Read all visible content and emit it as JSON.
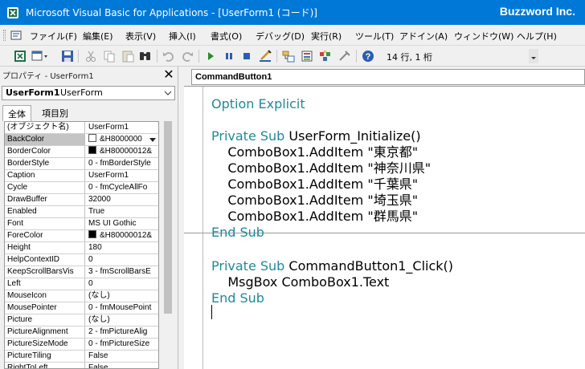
{
  "window": {
    "title": "Microsoft Visual Basic for Applications - [UserForm1 (コード)]",
    "brand": "Buzzword Inc."
  },
  "menu": [
    {
      "id": "file",
      "label": "ファイル(F)"
    },
    {
      "id": "edit",
      "label": "編集(E)"
    },
    {
      "id": "view",
      "label": "表示(V)"
    },
    {
      "id": "insert",
      "label": "挿入(I)"
    },
    {
      "id": "format",
      "label": "書式(O)"
    },
    {
      "id": "debug",
      "label": "デバッグ(D)"
    },
    {
      "id": "run",
      "label": "実行(R)"
    },
    {
      "id": "tools",
      "label": "ツール(T)"
    },
    {
      "id": "addins",
      "label": "アドイン(A)"
    },
    {
      "id": "window",
      "label": "ウィンドウ(W)"
    },
    {
      "id": "help",
      "label": "ヘルプ(H)"
    }
  ],
  "toolbar": {
    "position": "14 行, 1 桁",
    "icons": [
      "excel-icon",
      "insert-dropdown-icon",
      "save-icon",
      "cut-icon",
      "copy-icon",
      "paste-icon",
      "find-icon",
      "undo-icon",
      "redo-icon",
      "run-icon",
      "break-icon",
      "reset-icon",
      "design-mode-icon",
      "project-explorer-icon",
      "properties-icon",
      "object-browser-icon",
      "toolbox-icon",
      "help-icon"
    ]
  },
  "properties": {
    "title": "プロパティ - UserForm1",
    "object_name": "UserForm1",
    "object_type": "UserForm",
    "tabs": [
      "全体",
      "項目別"
    ],
    "rows": [
      {
        "name": "(オブジェクト名)",
        "value": "UserForm1"
      },
      {
        "name": "BackColor",
        "value": "&H8000000",
        "swatch": "#ffffff",
        "selected": true
      },
      {
        "name": "BorderColor",
        "value": "&H80000012&",
        "swatch": "#000000"
      },
      {
        "name": "BorderStyle",
        "value": "0 - fmBorderStyle"
      },
      {
        "name": "Caption",
        "value": "UserForm1"
      },
      {
        "name": "Cycle",
        "value": "0 - fmCycleAllFo"
      },
      {
        "name": "DrawBuffer",
        "value": "32000"
      },
      {
        "name": "Enabled",
        "value": "True"
      },
      {
        "name": "Font",
        "value": "MS UI Gothic"
      },
      {
        "name": "ForeColor",
        "value": "&H80000012&",
        "swatch": "#000000"
      },
      {
        "name": "Height",
        "value": "180"
      },
      {
        "name": "HelpContextID",
        "value": "0"
      },
      {
        "name": "KeepScrollBarsVis",
        "value": "3 - fmScrollBarsE"
      },
      {
        "name": "Left",
        "value": "0"
      },
      {
        "name": "MouseIcon",
        "value": "(なし)"
      },
      {
        "name": "MousePointer",
        "value": "0 - fmMousePoint"
      },
      {
        "name": "Picture",
        "value": "(なし)"
      },
      {
        "name": "PictureAlignment",
        "value": "2 - fmPictureAlig"
      },
      {
        "name": "PictureSizeMode",
        "value": "0 - fmPictureSize"
      },
      {
        "name": "PictureTiling",
        "value": "False"
      },
      {
        "name": "RightToLeft",
        "value": "False"
      }
    ]
  },
  "code": {
    "object_combo": "CommandButton1",
    "lines": [
      {
        "kw": "Option Explicit",
        "text": ""
      },
      {
        "kw": "",
        "text": ""
      },
      {
        "kw": "Private Sub",
        "text": " UserForm_Initialize()"
      },
      {
        "kw": "",
        "text": "    ComboBox1.AddItem \"東京都\""
      },
      {
        "kw": "",
        "text": "    ComboBox1.AddItem \"神奈川県\""
      },
      {
        "kw": "",
        "text": "    ComboBox1.AddItem \"千葉県\""
      },
      {
        "kw": "",
        "text": "    ComboBox1.AddItem \"埼玉県\""
      },
      {
        "kw": "",
        "text": "    ComboBox1.AddItem \"群馬県\""
      },
      {
        "kw": "End Sub",
        "text": ""
      },
      {
        "kw": "",
        "text": ""
      },
      {
        "kw": "Private Sub",
        "text": " CommandButton1_Click()"
      },
      {
        "kw": "",
        "text": "    MsgBox ComboBox1.Text"
      },
      {
        "kw": "End Sub",
        "text": ""
      }
    ]
  },
  "colors": {
    "titlebar": "#0078d7",
    "keyword": "#1e8a9a"
  }
}
